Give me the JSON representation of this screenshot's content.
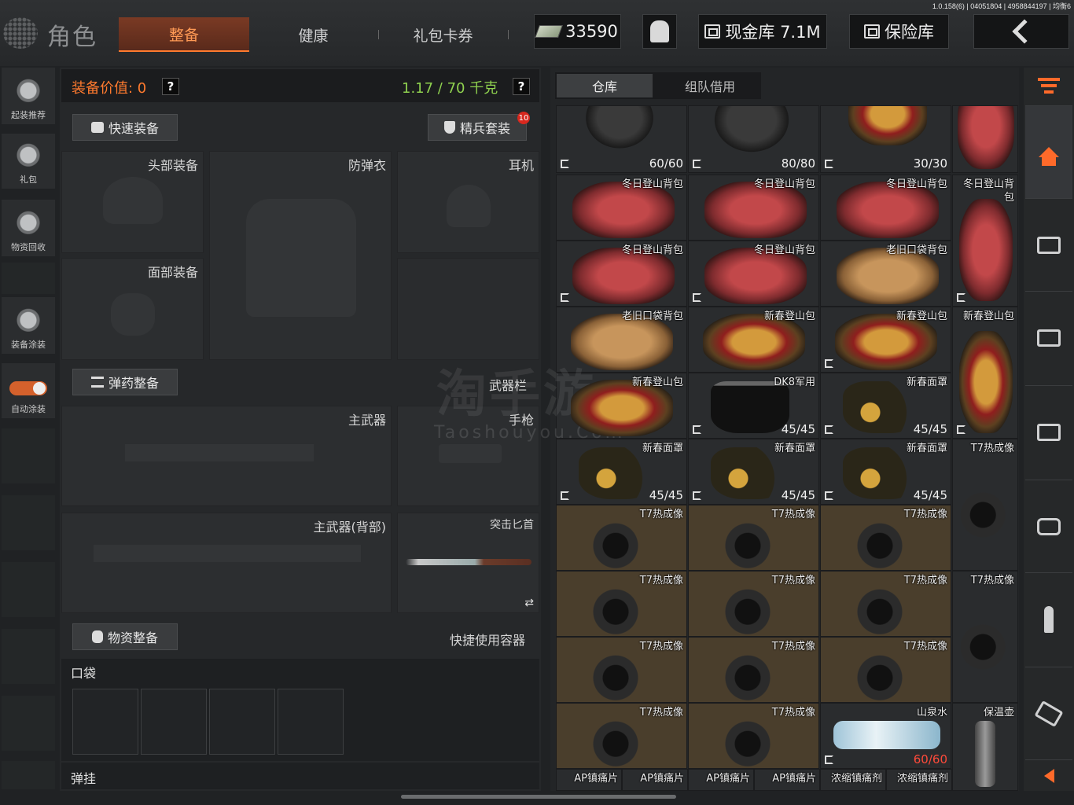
{
  "version": "1.0.158(6) | 04051804 | 4958844197 | 均衡6",
  "header": {
    "title": "角色",
    "tabs": [
      {
        "label": "整备",
        "active": true
      },
      {
        "label": "健康",
        "active": false
      },
      {
        "label": "礼包卡券",
        "active": false
      }
    ],
    "money": "33590",
    "cash_vault": "现金库 7.1M",
    "safe": "保险库"
  },
  "left_sidebar": [
    {
      "label": "起装推荐",
      "icon": "gun-helmet-icon"
    },
    {
      "label": "礼包",
      "icon": "gift-icon"
    },
    {
      "label": "物资回收",
      "icon": "recycle-icon"
    },
    {
      "label": "装备涂装",
      "icon": "paint-helmet-icon"
    },
    {
      "label": "自动涂装",
      "icon": "toggle-icon",
      "toggle_on": true
    }
  ],
  "equipment": {
    "value_label": "装备价值: 0",
    "weight": "1.17 / 70 千克",
    "quick_equip": "快速装备",
    "elite_set": "精兵套装",
    "elite_badge": "10",
    "slots": {
      "head": "头部装备",
      "armor": "防弹衣",
      "headset": "耳机",
      "face": "面部装备",
      "ammo_btn": "弹药整备",
      "weapon_bar": "武器栏",
      "primary": "主武器",
      "pistol": "手枪",
      "primary_back": "主武器(背部)",
      "knife": "突击匕首",
      "supply_btn": "物资整备",
      "quick_container": "快捷使用容器",
      "pocket": "口袋",
      "sling": "弹挂"
    }
  },
  "inventory": {
    "tabs": [
      "仓库",
      "组队借用"
    ],
    "items": {
      "r0c0": {
        "name": "",
        "count": "60/60"
      },
      "r0c1": {
        "name": "",
        "count": "80/80"
      },
      "r0c2": {
        "name": "",
        "count": "30/30"
      },
      "winter_bag": "冬日登山背包",
      "winter_bag_tall": "冬日登山背\n包",
      "old_bag": "老旧口袋背包",
      "ny_bag": "新春登山包",
      "dk8": "DK8军用",
      "ny_mask": "新春面罩",
      "mask_count": "45/45",
      "t7": "T7热成像",
      "water": "山泉水",
      "water_count": "60/60",
      "thermos": "保温壶",
      "ap_pain": "AP镇痛片",
      "strong_pain": "浓缩镇痛剂"
    }
  },
  "watermark": {
    "main": "淘手游",
    "sub": "Taoshouyou.Com"
  }
}
